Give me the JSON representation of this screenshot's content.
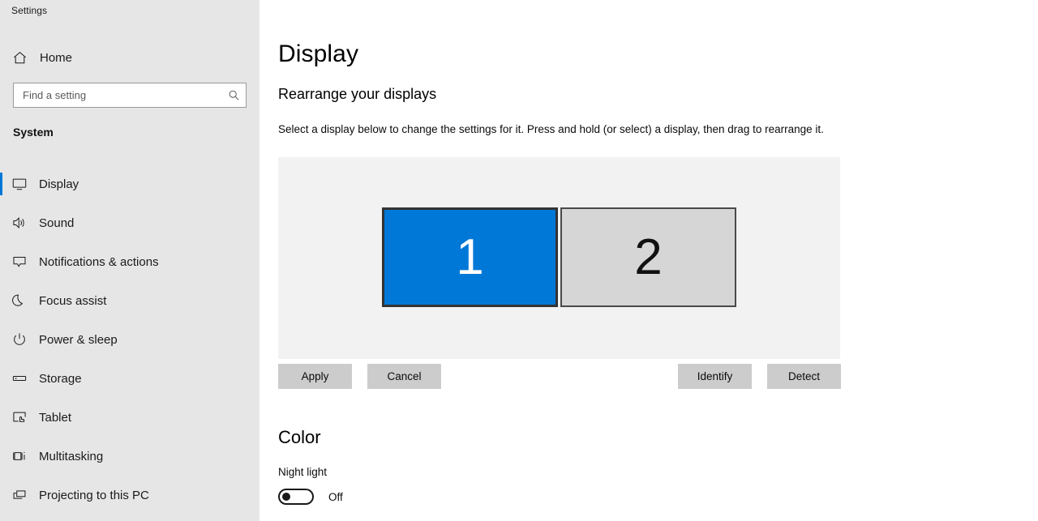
{
  "window": {
    "app_title": "Settings"
  },
  "sidebar": {
    "home_label": "Home",
    "home_icon": "home-icon",
    "search": {
      "placeholder": "Find a setting",
      "value": "",
      "icon": "search-icon"
    },
    "section_label": "System",
    "items": [
      {
        "label": "Display",
        "icon": "monitor-icon",
        "selected": true
      },
      {
        "label": "Sound",
        "icon": "speaker-icon",
        "selected": false
      },
      {
        "label": "Notifications & actions",
        "icon": "notification-icon",
        "selected": false
      },
      {
        "label": "Focus assist",
        "icon": "moon-icon",
        "selected": false
      },
      {
        "label": "Power & sleep",
        "icon": "power-icon",
        "selected": false
      },
      {
        "label": "Storage",
        "icon": "drive-icon",
        "selected": false
      },
      {
        "label": "Tablet",
        "icon": "tablet-touch-icon",
        "selected": false
      },
      {
        "label": "Multitasking",
        "icon": "task-view-icon",
        "selected": false
      },
      {
        "label": "Projecting to this PC",
        "icon": "project-screen-icon",
        "selected": false
      }
    ]
  },
  "main": {
    "page_title": "Display",
    "rearrange": {
      "heading": "Rearrange your displays",
      "description": "Select a display below to change the settings for it. Press and hold (or select) a display, then drag to rearrange it.",
      "displays": [
        {
          "number": "1",
          "selected": true
        },
        {
          "number": "2",
          "selected": false
        }
      ],
      "buttons": {
        "apply": "Apply",
        "cancel": "Cancel",
        "identify": "Identify",
        "detect": "Detect"
      }
    },
    "color": {
      "heading": "Color",
      "night_light_label": "Night light",
      "night_light_state": "Off",
      "night_light_on": false
    }
  },
  "colors": {
    "accent": "#0078d7",
    "sidebar_bg": "#e6e6e6",
    "main_bg": "#ffffff",
    "canvas_bg": "#f2f2f2",
    "button_bg": "#cccccc",
    "monitor_inactive_bg": "#d6d6d6"
  }
}
